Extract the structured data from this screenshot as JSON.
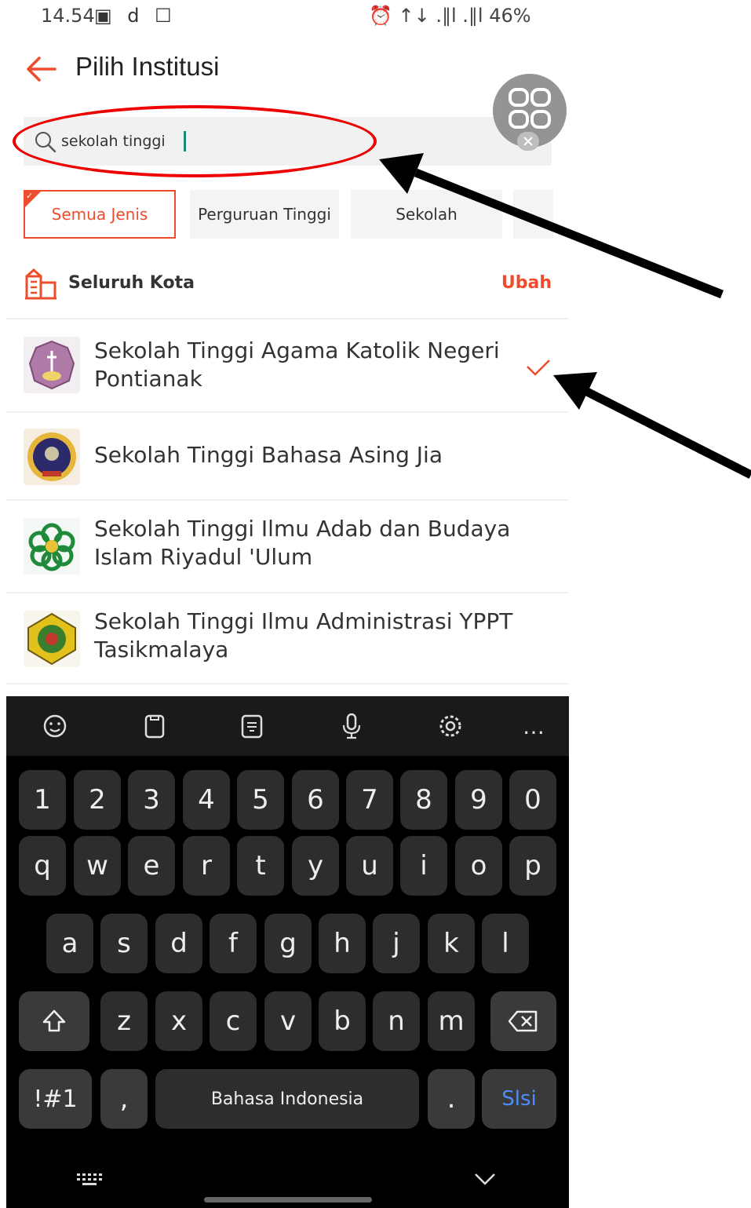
{
  "status_bar": {
    "time": "14.54",
    "left_icons": "▣ d ☐",
    "right_text": "⏰ ↑↓ .∥l .∥l 46%"
  },
  "header": {
    "title": "Pilih Institusi"
  },
  "search": {
    "value": "sekolah tinggi",
    "placeholder": ""
  },
  "filters": {
    "chips": [
      {
        "label": "Semua Jenis",
        "selected": true
      },
      {
        "label": "Perguruan Tinggi",
        "selected": false
      },
      {
        "label": "Sekolah",
        "selected": false
      }
    ]
  },
  "city": {
    "label": "Seluruh Kota",
    "action": "Ubah"
  },
  "institutions": [
    {
      "name": "Sekolah Tinggi Agama Katolik Negeri Pontianak",
      "selected": true,
      "logo_color": "#b07aa8"
    },
    {
      "name": "Sekolah Tinggi Bahasa Asing Jia",
      "selected": false,
      "logo_color": "#2d2a6b"
    },
    {
      "name": "Sekolah Tinggi Ilmu Adab dan Budaya Islam Riyadul 'Ulum",
      "selected": false,
      "logo_color": "#1e8a3a"
    },
    {
      "name": "Sekolah Tinggi Ilmu Administrasi YPPT Tasikmalaya",
      "selected": false,
      "logo_color": "#e3c11b"
    }
  ],
  "keyboard": {
    "number_row": [
      "1",
      "2",
      "3",
      "4",
      "5",
      "6",
      "7",
      "8",
      "9",
      "0"
    ],
    "row1": [
      "q",
      "w",
      "e",
      "r",
      "t",
      "y",
      "u",
      "i",
      "o",
      "p"
    ],
    "row2": [
      "a",
      "s",
      "d",
      "f",
      "g",
      "h",
      "j",
      "k",
      "l"
    ],
    "row3": [
      "z",
      "x",
      "c",
      "v",
      "b",
      "n",
      "m"
    ],
    "symbols_key": "!#1",
    "comma_key": ",",
    "space_label": "Bahasa Indonesia",
    "period_key": ".",
    "enter_label": "Slsi",
    "toolbar_more": "…"
  },
  "colors": {
    "accent": "#ee4d2d",
    "annotation": "#e00000"
  }
}
